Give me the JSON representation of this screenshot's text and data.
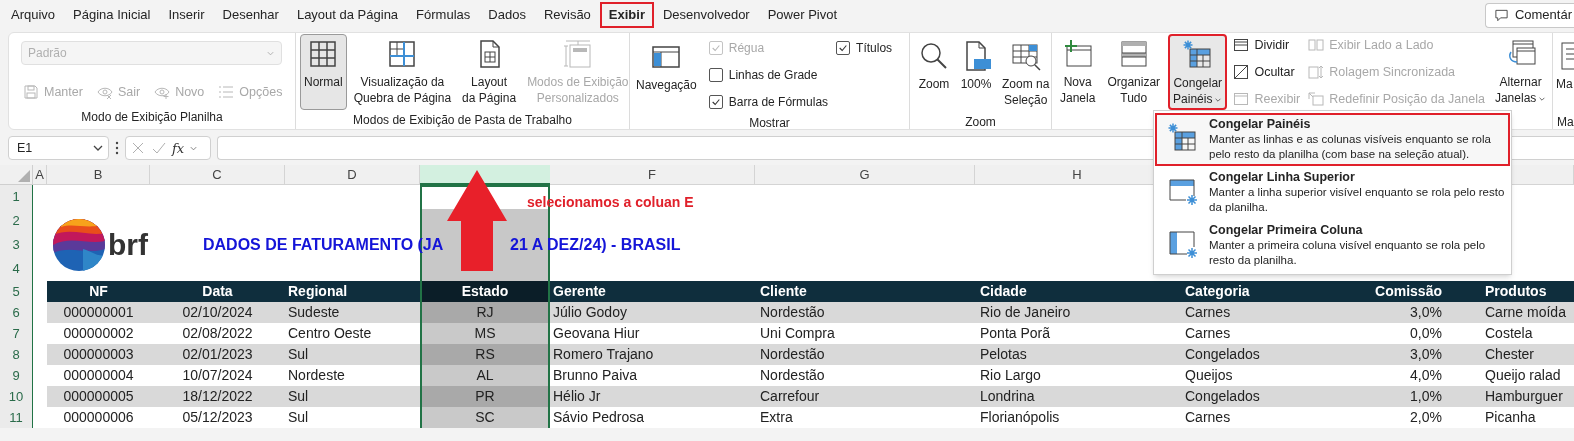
{
  "ribbon_tabs": [
    {
      "label": "Arquivo",
      "selected": false,
      "highlighted": false
    },
    {
      "label": "Página Inicial",
      "selected": false,
      "highlighted": false
    },
    {
      "label": "Inserir",
      "selected": false,
      "highlighted": false
    },
    {
      "label": "Desenhar",
      "selected": false,
      "highlighted": false
    },
    {
      "label": "Layout da Página",
      "selected": false,
      "highlighted": false
    },
    {
      "label": "Fórmulas",
      "selected": false,
      "highlighted": false
    },
    {
      "label": "Dados",
      "selected": false,
      "highlighted": false
    },
    {
      "label": "Revisão",
      "selected": false,
      "highlighted": false
    },
    {
      "label": "Exibir",
      "selected": true,
      "highlighted": true
    },
    {
      "label": "Desenvolvedor",
      "selected": false,
      "highlighted": false
    },
    {
      "label": "Power Pivot",
      "selected": false,
      "highlighted": false
    }
  ],
  "comments_button": {
    "label": "Comentár"
  },
  "ribbon_groups": [
    {
      "label": "Modo de Exibição Planilha",
      "items": [
        {
          "kind": "stack",
          "items": [
            {
              "kind": "dropdown",
              "value": "Padrão",
              "disabled": true
            },
            {
              "kind": "row",
              "items": [
                {
                  "kind": "small",
                  "label": "Manter",
                  "disabled": true
                },
                {
                  "kind": "small",
                  "label": "Sair",
                  "disabled": true
                },
                {
                  "kind": "small",
                  "label": "Novo",
                  "disabled": true
                },
                {
                  "kind": "small",
                  "label": "Opções",
                  "disabled": true
                }
              ]
            }
          ]
        }
      ]
    },
    {
      "label": "Modos de Exibição de Pasta de Trabalho",
      "items": [
        {
          "kind": "large",
          "label": "Normal",
          "selected": true,
          "disabled": false
        },
        {
          "kind": "large",
          "label": "Visualização da\nQuebra de Página",
          "selected": false,
          "disabled": false
        },
        {
          "kind": "large",
          "label": "Layout\nda Página",
          "selected": false,
          "disabled": false
        },
        {
          "kind": "large",
          "label": "Modos de Exibição\nPersonalizados",
          "selected": false,
          "disabled": true
        }
      ]
    },
    {
      "label": "Mostrar",
      "items": [
        {
          "kind": "large",
          "label": "Navegação",
          "disabled": false
        },
        {
          "kind": "stack",
          "items": [
            {
              "kind": "checkbox",
              "label": "Régua",
              "checked": true,
              "disabled": true
            },
            {
              "kind": "checkbox",
              "label": "Linhas de Grade",
              "checked": false,
              "disabled": false
            },
            {
              "kind": "checkbox",
              "label": "Barra de Fórmulas",
              "checked": true,
              "disabled": false
            }
          ]
        },
        {
          "kind": "stack",
          "items": [
            {
              "kind": "checkbox",
              "label": "Títulos",
              "checked": true,
              "disabled": false
            }
          ]
        }
      ]
    },
    {
      "label": "Zoom",
      "items": [
        {
          "kind": "large",
          "label": "Zoom",
          "disabled": false
        },
        {
          "kind": "large",
          "label": "100%",
          "disabled": false
        },
        {
          "kind": "large",
          "label": "Zoom na\nSeleção",
          "disabled": false
        }
      ]
    },
    {
      "items": [
        {
          "kind": "large",
          "label": "Nova\nJanela",
          "disabled": false,
          "highlighted": false
        },
        {
          "kind": "large",
          "label": "Organizar\nTudo",
          "disabled": false,
          "highlighted": false
        },
        {
          "kind": "large",
          "label": "Congelar\nPainéis",
          "disabled": false,
          "highlighted": true,
          "dropdown": true
        },
        {
          "kind": "stack",
          "items": [
            {
              "kind": "small",
              "label": "Dividir",
              "disabled": false
            },
            {
              "kind": "small",
              "label": "Ocultar",
              "disabled": false
            },
            {
              "kind": "small",
              "label": "Reexibir",
              "disabled": true
            }
          ]
        },
        {
          "kind": "stack",
          "items": [
            {
              "kind": "small",
              "label": "Exibir Lado a Lado",
              "disabled": true
            },
            {
              "kind": "small",
              "label": "Rolagem Sincronizada",
              "disabled": true
            },
            {
              "kind": "small",
              "label": "Redefinir Posição da Janela",
              "disabled": true
            }
          ]
        },
        {
          "kind": "large",
          "label": "Alternar\nJanelas",
          "disabled": false,
          "highlighted": false,
          "dropdown": true
        }
      ]
    },
    {
      "label": "Ma",
      "items": [
        {
          "kind": "large",
          "label": "Ma",
          "disabled": false
        }
      ]
    }
  ],
  "formula_bar": {
    "name_box": "E1",
    "function_button": "fx"
  },
  "sheet": {
    "column_headers": [
      {
        "letter": "A",
        "selected": false
      },
      {
        "letter": "B",
        "selected": false
      },
      {
        "letter": "C",
        "selected": false
      },
      {
        "letter": "D",
        "selected": false
      },
      {
        "selected": true
      },
      {
        "letter": "F",
        "selected": false
      },
      {
        "letter": "G",
        "selected": false
      },
      {
        "letter": "H",
        "selected": false
      }
    ],
    "row_numbers": [
      "1",
      "2",
      "3",
      "4",
      "5",
      "6",
      "7",
      "8",
      "9",
      "10",
      "11"
    ],
    "annotation": "selecionamos a coluan E",
    "logo_text": "brf",
    "title_parts": [
      "DADOS DE FATURAMENTO (JA",
      "21 A DEZ/24) - BRASIL"
    ],
    "table": {
      "columns": [
        "NF",
        "Data",
        "Regional",
        "Estado",
        "Gerente",
        "Cliente",
        "Cidade",
        "Categoria",
        "Comissão",
        "Produtos"
      ],
      "rows": [
        [
          "000000001",
          "02/10/2024",
          "Sudeste",
          "RJ",
          "Júlio Godoy",
          "Nordestão",
          "Rio de Janeiro",
          "Carnes",
          "3,0%",
          "Carne moída"
        ],
        [
          "000000002",
          "02/08/2022",
          "Centro Oeste",
          "MS",
          "Geovana Hiur",
          "Uni Compra",
          "Ponta Porã",
          "Carnes",
          "0,0%",
          "Costela"
        ],
        [
          "000000003",
          "02/01/2023",
          "Sul",
          "RS",
          "Romero Trajano",
          "Nordestão",
          "Pelotas",
          "Congelados",
          "3,0%",
          "Chester"
        ],
        [
          "000000004",
          "10/07/2024",
          "Nordeste",
          "AL",
          "Brunno Paiva",
          "Nordestão",
          "Rio Largo",
          "Queijos",
          "4,0%",
          "Queijo ralad"
        ],
        [
          "000000005",
          "18/12/2022",
          "Sul",
          "PR",
          "Hélio Jr",
          "Carrefour",
          "Londrina",
          "Congelados",
          "1,0%",
          "Hamburguer"
        ],
        [
          "000000006",
          "05/12/2023",
          "Sul",
          "SC",
          "Sávio Pedrosa",
          "Extra",
          "Florianópolis",
          "Carnes",
          "2,0%",
          "Picanha"
        ]
      ]
    }
  },
  "freeze_menu": {
    "items": [
      {
        "title": "Congelar Painéis",
        "description": "Manter as linhas e as colunas visíveis enquanto se rola pelo resto da planilha (com base na seleção atual).",
        "highlighted": true
      },
      {
        "title": "Congelar Linha Superior",
        "description": "Manter a linha superior visível enquanto se rola pelo resto da planilha.",
        "highlighted": false
      },
      {
        "title": "Congelar Primeira Coluna",
        "description": "Manter a primeira coluna visível enquanto se rola pelo resto da planilha.",
        "highlighted": false
      }
    ]
  }
}
